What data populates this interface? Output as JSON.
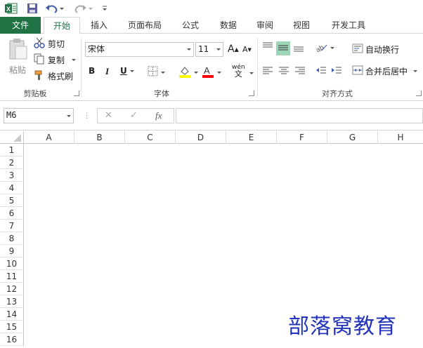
{
  "qat": {
    "save": "save-icon",
    "undo": "undo-icon",
    "redo": "redo-icon"
  },
  "tabs": [
    {
      "label": "文件"
    },
    {
      "label": "开始"
    },
    {
      "label": "插入"
    },
    {
      "label": "页面布局"
    },
    {
      "label": "公式"
    },
    {
      "label": "数据"
    },
    {
      "label": "审阅"
    },
    {
      "label": "视图"
    },
    {
      "label": "开发工具"
    }
  ],
  "clipboard": {
    "paste": "粘贴",
    "cut": "剪切",
    "copy": "复制",
    "format_painter": "格式刷",
    "group": "剪贴板"
  },
  "font": {
    "name": "宋体",
    "size": "11",
    "bold": "B",
    "italic": "I",
    "underline": "U",
    "grow": "A",
    "shrink": "A",
    "phonetic": "wén",
    "group": "字体"
  },
  "alignment": {
    "wrap": "自动换行",
    "merge": "合并后居中",
    "group": "对齐方式"
  },
  "formula_bar": {
    "name_box": "M6",
    "fx": "fx",
    "cancel": "✕",
    "enter": "✓",
    "value": ""
  },
  "columns": [
    "A",
    "B",
    "C",
    "D",
    "E",
    "F",
    "G",
    "H"
  ],
  "rows": [
    "1",
    "2",
    "3",
    "4",
    "5",
    "6",
    "7",
    "8",
    "9",
    "10",
    "11",
    "12",
    "13",
    "14",
    "15",
    "16"
  ],
  "watermark": "部落窝教育",
  "colors": {
    "accent": "#217346",
    "highlight": "#ffff00",
    "font_color": "#ff0000"
  }
}
